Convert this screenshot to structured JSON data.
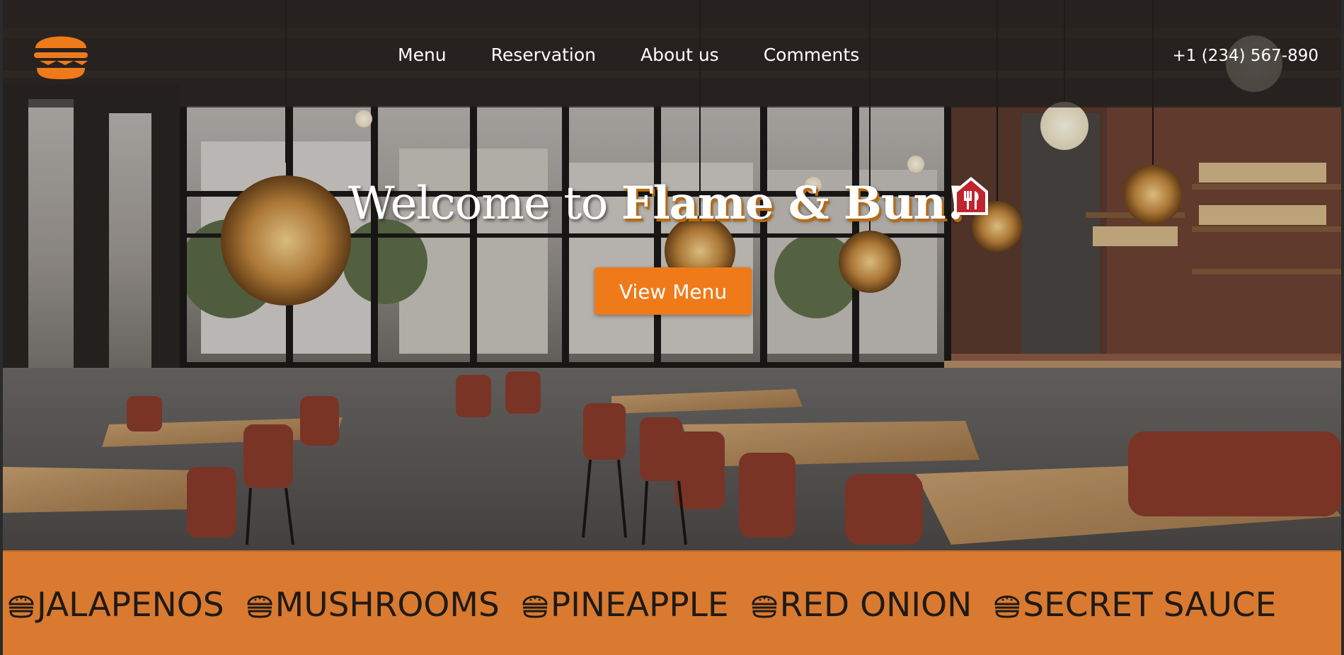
{
  "header": {
    "logo_icon": "burger-icon",
    "nav": [
      {
        "label": "Menu"
      },
      {
        "label": "Reservation"
      },
      {
        "label": "About us"
      },
      {
        "label": "Comments"
      }
    ],
    "phone": "+1 (234) 567-890"
  },
  "hero": {
    "title_lead": "Welcome to ",
    "title_brand": "Flame & Bun!",
    "title_icon": "restaurant-house-icon",
    "cta_label": "View Menu",
    "background": "restaurant-interior-photo"
  },
  "ticker": {
    "item_icon": "burger-icon",
    "items": [
      "JALAPENOS",
      "MUSHROOMS",
      "PINEAPPLE",
      "RED ONION",
      "SECRET SAUCE"
    ]
  },
  "colors": {
    "accent": "#ef7a1a",
    "ticker_bg": "#d97a30",
    "header_bg": "#23201e",
    "brand_shadow": "#b86a10"
  }
}
